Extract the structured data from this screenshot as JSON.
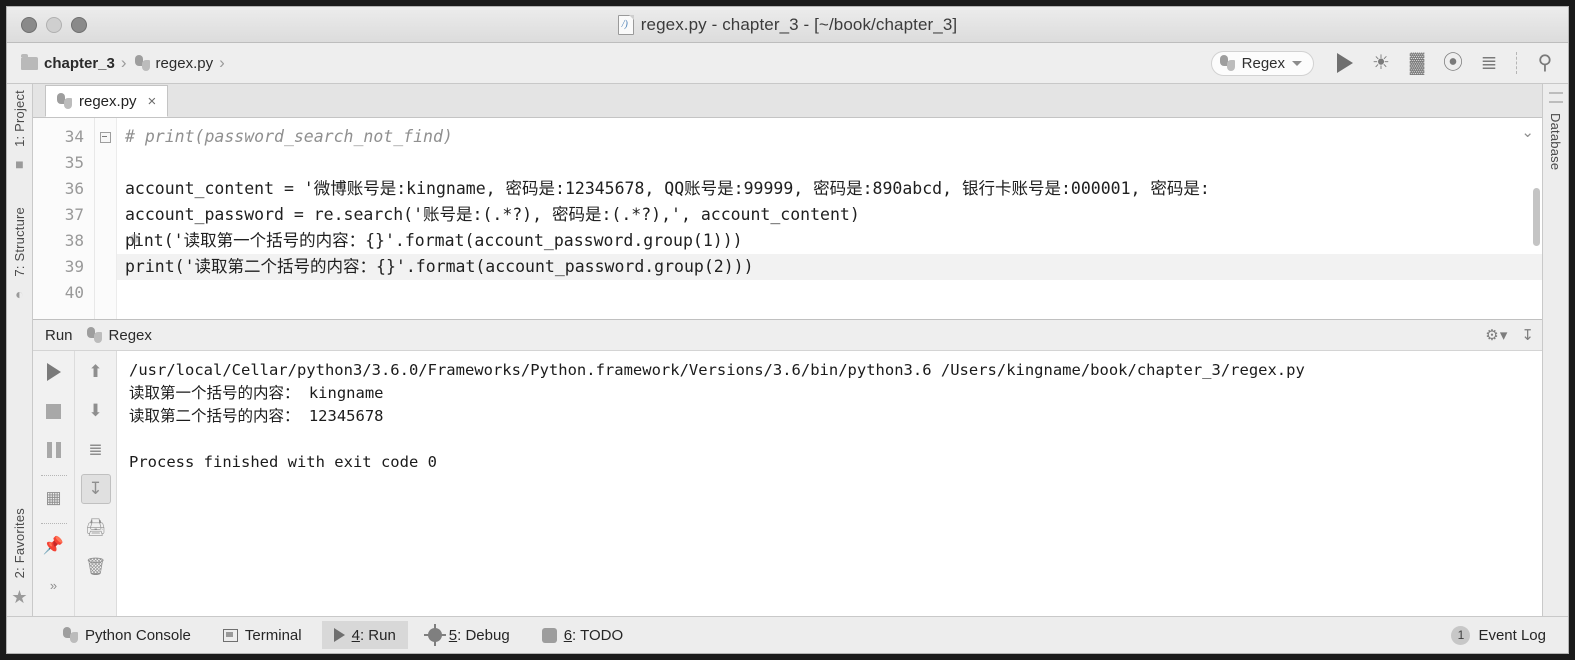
{
  "window": {
    "title": "regex.py - chapter_3 - [~/book/chapter_3]",
    "file_icon": "python-file-icon"
  },
  "navbar": {
    "breadcrumbs": [
      {
        "label": "chapter_3",
        "icon": "folder-icon"
      },
      {
        "label": "regex.py",
        "icon": "python-file-icon"
      }
    ],
    "separator": "›",
    "run_config": {
      "label": "Regex",
      "icon": "python-icon",
      "caret": "▾"
    },
    "actions": [
      {
        "name": "run-button",
        "glyph": "▶"
      },
      {
        "name": "debug-button",
        "glyph": "☀"
      },
      {
        "name": "coverage-button",
        "glyph": "▓"
      },
      {
        "name": "profile-button",
        "glyph": "⦿"
      },
      {
        "name": "run-with-console-button",
        "glyph": "≡"
      },
      {
        "name": "search-everywhere-button",
        "glyph": "⚲"
      }
    ]
  },
  "left_strip": {
    "items": [
      {
        "label": "1: Project",
        "icon": "project-icon"
      },
      {
        "label": "7: Structure",
        "icon": "structure-icon"
      },
      {
        "label": "2: Favorites",
        "icon": "favorites-star-icon"
      }
    ]
  },
  "right_strip": {
    "items": [
      {
        "label": "Database",
        "icon": "database-icon"
      }
    ]
  },
  "editor": {
    "tab": {
      "label": "regex.py",
      "close": "×",
      "icon": "python-file-icon"
    },
    "lines": [
      {
        "num": "34",
        "text": "# print(password_search_not_find)",
        "style": "comment",
        "fold": true
      },
      {
        "num": "35",
        "text": "",
        "style": "plain",
        "fold": false
      },
      {
        "num": "36",
        "text": "account_content = '微博账号是:kingname, 密码是:12345678, QQ账号是:99999, 密码是:890abcd, 银行卡账号是:000001, 密码是:",
        "style": "plain",
        "fold": false
      },
      {
        "num": "37",
        "text": "account_password = re.search('账号是:(.*?), 密码是:(.*?),', account_content)",
        "style": "plain",
        "fold": false
      },
      {
        "num": "38",
        "text": "print('读取第一个括号的内容：{}'.format(account_password.group(1)))",
        "style": "cursor",
        "fold": false
      },
      {
        "num": "39",
        "text": "print('读取第二个括号的内容：{}'.format(account_password.group(2)))",
        "style": "highlight",
        "fold": false
      },
      {
        "num": "40",
        "text": "",
        "style": "plain",
        "fold": false
      }
    ]
  },
  "run_window": {
    "title": "Run",
    "tab_label": "Regex",
    "tab_icon": "python-icon",
    "settings_icon": "gear-icon",
    "minimize_icon": "hide-icon",
    "toolbar_left": [
      {
        "name": "rerun-button",
        "icon": "play-icon"
      },
      {
        "name": "stop-button",
        "icon": "stop-icon"
      },
      {
        "name": "pause-button",
        "icon": "pause-icon"
      },
      {
        "name": "toggle-tasks-button",
        "icon": "layout-icon"
      },
      {
        "name": "pin-tab-button",
        "icon": "pin-icon"
      },
      {
        "name": "more-button",
        "icon": "chevrons-right-icon"
      }
    ],
    "toolbar_right": [
      {
        "name": "up-stacktrace-button",
        "icon": "arrow-up-icon"
      },
      {
        "name": "down-stacktrace-button",
        "icon": "arrow-down-icon"
      },
      {
        "name": "soft-wrap-button",
        "icon": "wrap-icon"
      },
      {
        "name": "scroll-to-end-button",
        "icon": "scroll-end-icon"
      },
      {
        "name": "print-button",
        "icon": "printer-icon"
      },
      {
        "name": "clear-all-button",
        "icon": "trash-icon"
      }
    ],
    "console_lines": [
      "/usr/local/Cellar/python3/3.6.0/Frameworks/Python.framework/Versions/3.6/bin/python3.6 /Users/kingname/book/chapter_3/regex.py",
      "读取第一个括号的内容： kingname",
      "读取第二个括号的内容： 12345678",
      "",
      "Process finished with exit code 0"
    ]
  },
  "status_bar": {
    "items": [
      {
        "label": "Python Console",
        "icon": "python-icon",
        "active": false
      },
      {
        "label": "Terminal",
        "icon": "terminal-icon",
        "active": false
      },
      {
        "label": "4: Run",
        "mnemonic": "4",
        "rest": ": Run",
        "icon": "play-icon",
        "active": true
      },
      {
        "label": "5: Debug",
        "mnemonic": "5",
        "rest": ": Debug",
        "icon": "bug-icon",
        "active": false
      },
      {
        "label": "6: TODO",
        "mnemonic": "6",
        "rest": ": TODO",
        "icon": "todo-icon",
        "active": false
      }
    ],
    "event_log": {
      "count": "1",
      "label": "Event Log"
    }
  },
  "colors": {
    "window_bg": "#f1f1f1",
    "editor_bg": "#ffffff",
    "accent_selected": "#d8d8d8",
    "text": "#262626",
    "comment": "#909090"
  }
}
